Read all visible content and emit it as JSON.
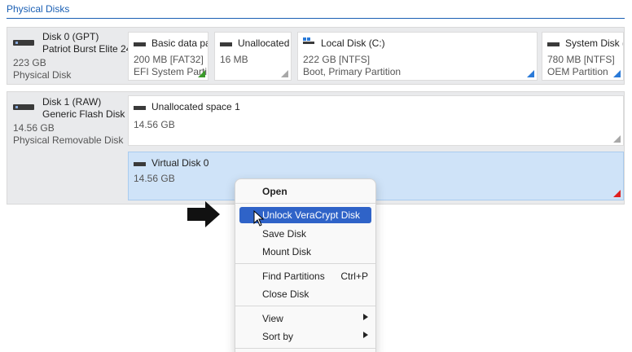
{
  "section": {
    "title": "Physical Disks"
  },
  "disks": [
    {
      "name": "Disk 0 (GPT)",
      "model": "Patriot Burst Elite 24",
      "size": "223 GB",
      "type": "Physical Disk",
      "partitions": [
        {
          "label": "Basic data pa",
          "line1": "200 MB [FAT32]",
          "line2": "EFI System Parti",
          "corner": "green",
          "icon": "disk-icon"
        },
        {
          "label": "Unallocated s",
          "line1": "16 MB",
          "line2": "",
          "corner": "gray",
          "icon": "disk-icon"
        },
        {
          "label": "Local Disk (C:)",
          "line1": "222 GB [NTFS]",
          "line2": "Boot, Primary Partition",
          "corner": "blue",
          "icon": "windows-disk-icon"
        },
        {
          "label": "System Disk (",
          "line1": "780 MB [NTFS]",
          "line2": "OEM Partition",
          "corner": "blue",
          "icon": "disk-icon"
        }
      ]
    },
    {
      "name": "Disk 1 (RAW)",
      "model": "Generic Flash Disk",
      "size": "14.56 GB",
      "type": "Physical Removable Disk",
      "partitions": [
        {
          "label": "Unallocated space 1",
          "line1": "14.56 GB",
          "corner": "gray",
          "icon": "disk-icon"
        },
        {
          "label": "Virtual Disk 0",
          "line1": "14.56 GB",
          "corner": "red",
          "icon": "disk-icon",
          "selected": true
        }
      ]
    }
  ],
  "context_menu": {
    "items": [
      {
        "label": "Open",
        "bold": true
      },
      {
        "label": "Unlock VeraCrypt Disk",
        "highlighted": true
      },
      {
        "label": "Save Disk"
      },
      {
        "label": "Mount Disk"
      },
      {
        "label": "Find Partitions",
        "shortcut": "Ctrl+P"
      },
      {
        "label": "Close Disk"
      },
      {
        "label": "View",
        "submenu": true
      },
      {
        "label": "Sort by",
        "submenu": true
      }
    ]
  },
  "colors": {
    "accent": "#1a5fb4",
    "highlight": "#2f63c8",
    "selected_partition": "#cfe3f8"
  },
  "icons": [
    "disk-icon",
    "windows-disk-icon",
    "arrow-right-icon",
    "mouse-cursor-icon",
    "submenu-arrow-icon"
  ]
}
